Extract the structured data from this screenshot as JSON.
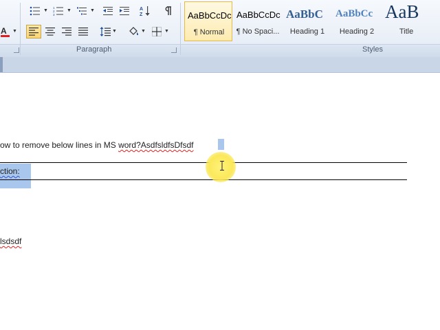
{
  "ribbon": {
    "groups": {
      "paragraph": "Paragraph",
      "styles": "Styles"
    },
    "styles": [
      {
        "sample": "AaBbCcDc",
        "name": "¶ Normal",
        "selected": true
      },
      {
        "sample": "AaBbCcDc",
        "name": "¶ No Spaci...",
        "selected": false
      },
      {
        "sample": "AaBbC",
        "name": "Heading 1",
        "selected": false
      },
      {
        "sample": "AaBbCc",
        "name": "Heading 2",
        "selected": false
      },
      {
        "sample": "AaB",
        "name": "Title",
        "selected": false
      }
    ],
    "icons": [
      "bullets-icon",
      "numbering-icon",
      "multilevel-list-icon",
      "decrease-indent-icon",
      "increase-indent-icon",
      "sort-icon",
      "pilcrow-icon",
      "font-color-icon",
      "align-left-icon",
      "center-icon",
      "align-right-icon",
      "justify-icon",
      "line-spacing-icon",
      "shading-icon",
      "borders-icon"
    ],
    "colors": {
      "accent": "#fbd573",
      "font_color_bar": "#e02020",
      "heading_blue": "#365f91",
      "title_color": "#17365d"
    }
  },
  "document": {
    "line1_plain": "ow to remove below lines in MS ",
    "line1_misspelled": "word?AsdfsldfsDfsdf",
    "line2": "ction:",
    "line3": "lsdsdf"
  }
}
